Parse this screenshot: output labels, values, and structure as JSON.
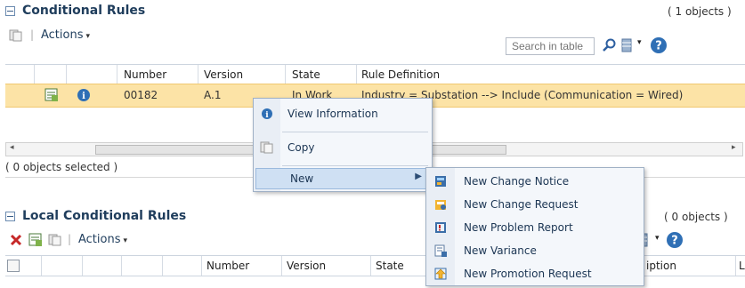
{
  "panel1": {
    "title": "Conditional Rules",
    "count": "( 1 objects )",
    "actions_label": "Actions",
    "search_placeholder": "Search in table",
    "columns": [
      "Number",
      "Version",
      "State",
      "Rule Definition"
    ],
    "row": {
      "number": "00182",
      "version": "A.1",
      "state": "In Work",
      "rule": "Industry = Substation --> Include (Communication = Wired)"
    },
    "selection_status": "( 0 objects selected )"
  },
  "panel2": {
    "title": "Local Conditional Rules",
    "count": "( 0 objects )",
    "actions_label": "Actions",
    "columns": [
      "Number",
      "Version",
      "State"
    ],
    "partial_columns": [
      "iption",
      "L"
    ]
  },
  "context_menu": {
    "items": [
      "View Information",
      "Copy",
      "New"
    ]
  },
  "submenu": {
    "items": [
      "New Change Notice",
      "New Change Request",
      "New Problem Report",
      "New Variance",
      "New Promotion Request"
    ]
  },
  "colors": {
    "selected_row": "#fce3a6",
    "menu_highlight": "#cfe0f3",
    "brand_text": "#1f3d5c"
  }
}
